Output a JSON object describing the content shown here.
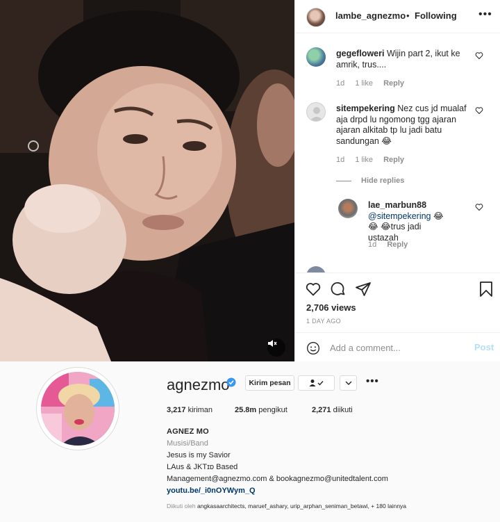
{
  "post": {
    "header": {
      "username": "lambe_agnezmo",
      "separator": "•",
      "follow_status": "Following",
      "more_icon": "more-horizontal-icon"
    },
    "comments": [
      {
        "username": "gegefloweri",
        "text": "Wijin part 2, ikut ke amrik, trus....",
        "age": "1d",
        "likes": "1 like",
        "reply": "Reply"
      },
      {
        "username": "sitempekering",
        "text": "Nez cus jd mualaf aja drpd lu ngomong tgg ajaran ajaran alkitab tp lu jadi batu sandungan 😂",
        "age": "1d",
        "likes": "1 like",
        "reply": "Reply"
      }
    ],
    "hide_replies": "Hide replies",
    "reply_comment": {
      "username": "lae_marbun88",
      "mention": "@sitempekering",
      "text": "😂😂 😂trus jadi ustazah",
      "age": "1d",
      "reply": "Reply"
    },
    "views": "2,706 views",
    "time_ago": "1 DAY AGO",
    "comment_placeholder": "Add a comment...",
    "post_button": "Post"
  },
  "profile": {
    "username": "agnezmo",
    "verified": true,
    "message_button": "Kirim pesan",
    "stats": {
      "posts": "3,217",
      "posts_label": "kiriman",
      "followers": "25.8m",
      "followers_label": "pengikut",
      "following": "2,271",
      "following_label": "diikuti"
    },
    "bio": {
      "name": "AGNEZ MO",
      "category": "Musisi/Band",
      "line1": "Jesus is my Savior",
      "line2": "LAus & JKTɪᴅ Based",
      "line3": "Management@agnezmo.com & bookagnezmo@unitedtalent.com",
      "link": "youtu.be/_i0nOYWym_Q"
    },
    "followed_by_prefix": "Diikuti oleh",
    "followed_by_names": "angkasaarchitects, maruef_ashary, urip_arphan_seniman_betawi,",
    "followed_by_more": "+ 180 lainnya"
  },
  "colors": {
    "verified_blue": "#3897f0",
    "link_blue": "#00376b",
    "muted_grey": "#8e8e8e",
    "post_button_disabled": "#b2dffc"
  }
}
